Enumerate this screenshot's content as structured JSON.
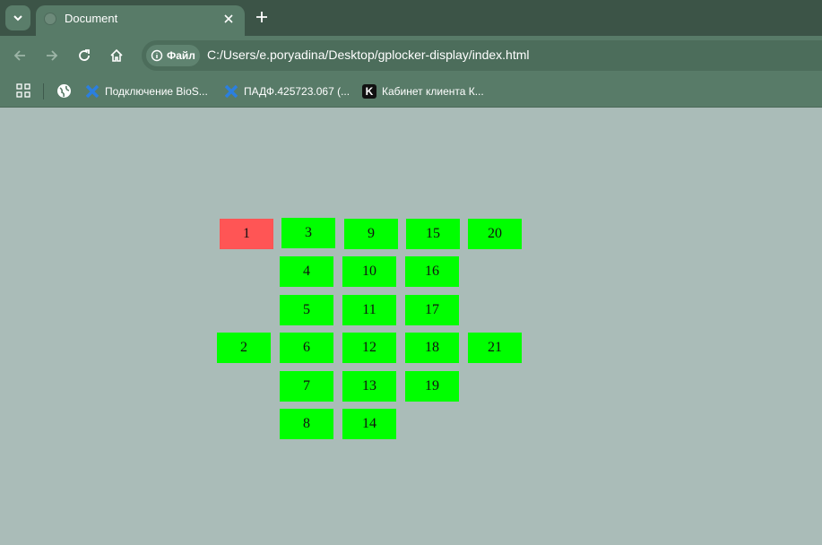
{
  "browser": {
    "tab": {
      "title": "Document"
    },
    "address": {
      "chip": "Файл",
      "url": "C:/Users/e.poryadina/Desktop/gplocker-display/index.html"
    },
    "bookmarks": [
      "Подключение BioS...",
      "ПАДФ.425723.067 (...",
      "Кабинет клиента К..."
    ]
  },
  "lockers": [
    {
      "num": "1",
      "status": "occupied",
      "color": "#ff5555"
    },
    {
      "num": "2",
      "status": "free",
      "color": "#00ff00"
    },
    {
      "num": "3",
      "status": "free",
      "color": "#00ff00"
    },
    {
      "num": "4",
      "status": "free",
      "color": "#00ff00"
    },
    {
      "num": "5",
      "status": "free",
      "color": "#00ff00"
    },
    {
      "num": "6",
      "status": "free",
      "color": "#00ff00"
    },
    {
      "num": "7",
      "status": "free",
      "color": "#00ff00"
    },
    {
      "num": "8",
      "status": "free",
      "color": "#00ff00"
    },
    {
      "num": "9",
      "status": "free",
      "color": "#00ff00"
    },
    {
      "num": "10",
      "status": "free",
      "color": "#00ff00"
    },
    {
      "num": "11",
      "status": "free",
      "color": "#00ff00"
    },
    {
      "num": "12",
      "status": "free",
      "color": "#00ff00"
    },
    {
      "num": "13",
      "status": "free",
      "color": "#00ff00"
    },
    {
      "num": "14",
      "status": "free",
      "color": "#00ff00"
    },
    {
      "num": "15",
      "status": "free",
      "color": "#00ff00"
    },
    {
      "num": "16",
      "status": "free",
      "color": "#00ff00"
    },
    {
      "num": "17",
      "status": "free",
      "color": "#00ff00"
    },
    {
      "num": "18",
      "status": "free",
      "color": "#00ff00"
    },
    {
      "num": "19",
      "status": "free",
      "color": "#00ff00"
    },
    {
      "num": "20",
      "status": "free",
      "color": "#00ff00"
    },
    {
      "num": "21",
      "status": "free",
      "color": "#00ff00"
    }
  ]
}
